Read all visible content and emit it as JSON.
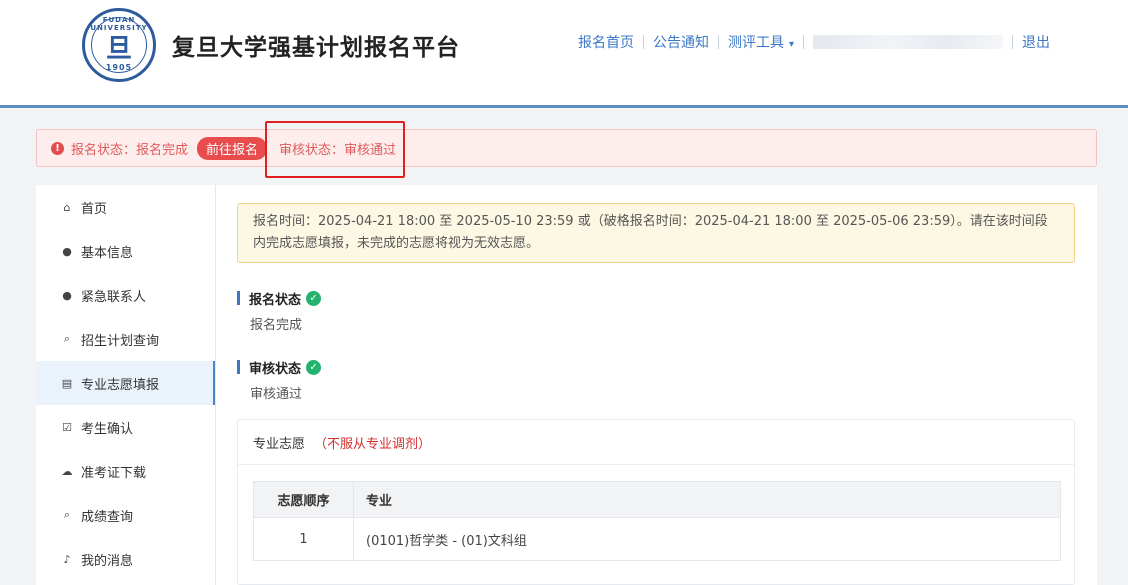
{
  "header": {
    "site_title": "复旦大学强基计划报名平台",
    "logo": {
      "arc_text": "FUDAN UNIVERSITY",
      "mark": "旦",
      "year": "1905"
    },
    "nav": {
      "home": "报名首页",
      "notices": "公告通知",
      "tools": "测评工具",
      "logout": "退出"
    }
  },
  "alert": {
    "reg_status": "报名状态：报名完成",
    "go_button": "前往报名",
    "review_status": "审核状态：审核通过"
  },
  "sidebar": {
    "items": [
      {
        "label": "首页",
        "icon": "home-icon",
        "glyph": "⌂"
      },
      {
        "label": "基本信息",
        "icon": "user-icon",
        "glyph": "●"
      },
      {
        "label": "紧急联系人",
        "icon": "user-icon",
        "glyph": "●"
      },
      {
        "label": "招生计划查询",
        "icon": "search-icon",
        "glyph": "⌕"
      },
      {
        "label": "专业志愿填报",
        "icon": "form-icon",
        "glyph": "▤"
      },
      {
        "label": "考生确认",
        "icon": "check-square-icon",
        "glyph": "☑"
      },
      {
        "label": "准考证下载",
        "icon": "cloud-download-icon",
        "glyph": "☁"
      },
      {
        "label": "成绩查询",
        "icon": "search-icon",
        "glyph": "⌕"
      },
      {
        "label": "我的消息",
        "icon": "bell-icon",
        "glyph": "♪"
      }
    ],
    "active_index": 4
  },
  "main": {
    "notice": "报名时间：2025-04-21 18:00 至 2025-05-10 23:59 或（破格报名时间：2025-04-21 18:00 至 2025-05-06 23:59）。请在该时间段内完成志愿填报，未完成的志愿将视为无效志愿。",
    "reg_section": {
      "title": "报名状态",
      "value": "报名完成"
    },
    "review_section": {
      "title": "审核状态",
      "value": "审核通过"
    },
    "wish": {
      "title": "专业志愿",
      "note": "（不服从专业调剂）",
      "columns": [
        "志愿顺序",
        "专业"
      ],
      "rows": [
        [
          "1",
          "(0101)哲学类 - (01)文科组"
        ]
      ]
    }
  },
  "colors": {
    "brand_blue": "#3c78c8",
    "alert_red": "#e84c4c",
    "success_green": "#24b36e",
    "annotation_red": "#e02020"
  }
}
